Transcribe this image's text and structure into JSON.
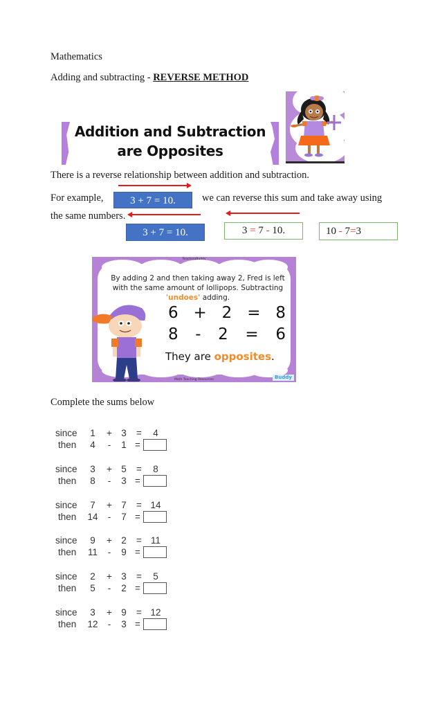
{
  "header": {
    "subject": "Mathematics",
    "heading_prefix": "Adding and subtracting - ",
    "heading_emphasis": "REVERSE METHOD"
  },
  "banner": {
    "line1": "Addition and Subtraction",
    "line2": "are Opposites",
    "accent_color": "#b57fdc"
  },
  "intro": {
    "sentence": "There is a reverse relationship between addition and subtraction.",
    "for_example": "For example,",
    "we_can": "we can reverse this sum and take away using",
    "same_numbers": "the same numbers."
  },
  "example_boxes": {
    "blue_top": "3 + 7 = 10.",
    "blue_bottom": "3 + 7 = 10.",
    "green1": {
      "a": "3",
      "eq": "=",
      "b": "7",
      "op": "-",
      "c": "10."
    },
    "green2": {
      "a": "10",
      "op": "-",
      "b": "7",
      "eq": "=",
      "c": "3"
    },
    "blue_color": "#4472c4",
    "green_border": "#7fb56a",
    "arrow_color": "#e31b1b"
  },
  "poster": {
    "top_credit": "TeachingBuddy",
    "bottom_credit": "Math Teaching Resources",
    "logo": "Buddy",
    "para_part1": "By adding 2 and then taking away 2, Fred is left with the same amount of lollipops. Subtracting ",
    "para_highlight": "'undoes'",
    "para_part2": " adding.",
    "eq1": [
      "6",
      "+",
      "2",
      "=",
      "8"
    ],
    "eq2": [
      "8",
      "-",
      "2",
      "=",
      "6"
    ],
    "conclusion_prefix": "They are ",
    "conclusion_highlight": "opposites",
    "conclusion_suffix": ".",
    "bg_color": "#b682d6",
    "highlight_color": "#f08c2c"
  },
  "worksheet": {
    "instruction": "Complete the sums below",
    "since_label": "since",
    "then_label": "then",
    "problems": [
      {
        "a": "1",
        "b": "3",
        "sum": "4",
        "then_a": "4",
        "then_b": "1",
        "answer": ""
      },
      {
        "a": "3",
        "b": "5",
        "sum": "8",
        "then_a": "8",
        "then_b": "3",
        "answer": ""
      },
      {
        "a": "7",
        "b": "7",
        "sum": "14",
        "then_a": "14",
        "then_b": "7",
        "answer": ""
      },
      {
        "a": "9",
        "b": "2",
        "sum": "11",
        "then_a": "11",
        "then_b": "9",
        "answer": ""
      },
      {
        "a": "2",
        "b": "3",
        "sum": "5",
        "then_a": "5",
        "then_b": "2",
        "answer": ""
      },
      {
        "a": "3",
        "b": "9",
        "sum": "12",
        "then_a": "12",
        "then_b": "3",
        "answer": ""
      }
    ],
    "plus": "+",
    "minus": "-",
    "equals": "="
  }
}
